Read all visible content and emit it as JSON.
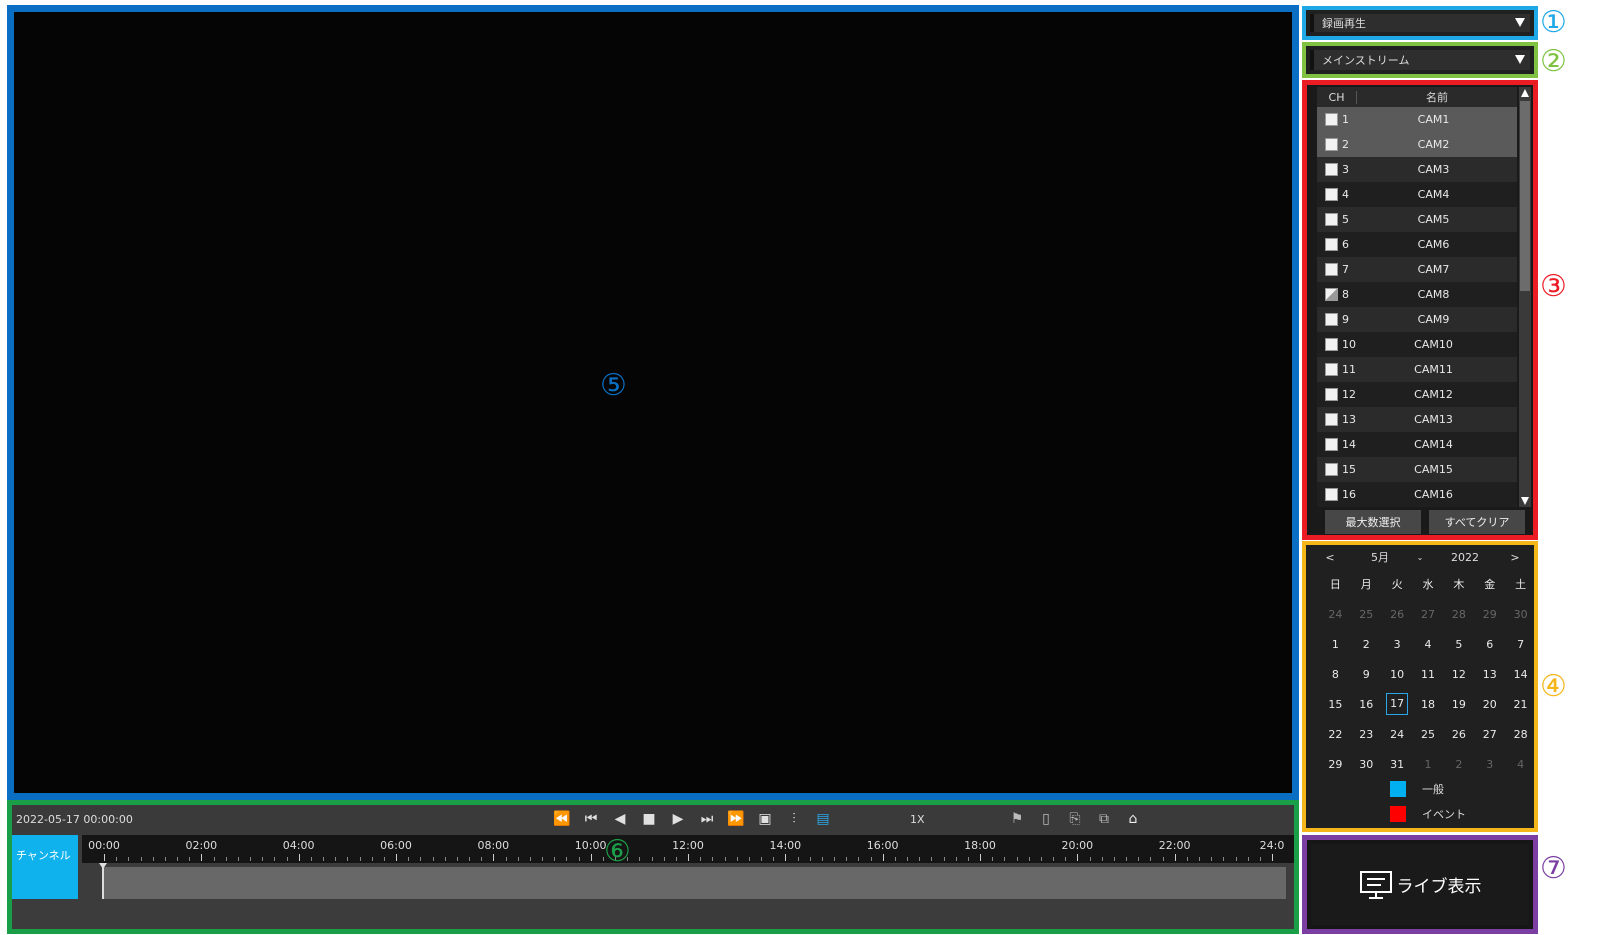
{
  "callouts": {
    "c1": "①",
    "c2": "②",
    "c3": "③",
    "c4": "④",
    "c5": "⑤",
    "c6": "⑥",
    "c7": "⑦"
  },
  "colors": {
    "frame1": "#1fa8e8",
    "frame2": "#7fc241",
    "frame3": "#ec1c24",
    "frame4": "#f4b619",
    "frame5": "#0a6fc2",
    "frame6": "#1b9e48",
    "frame7": "#7b3fa3",
    "legend_normal": "#00b0f0",
    "legend_event": "#ff0000"
  },
  "mode_select": {
    "value": "録画再生"
  },
  "stream_select": {
    "value": "メインストリーム"
  },
  "channels": {
    "header_ch": "CH",
    "header_name": "名前",
    "rows": [
      {
        "num": "1",
        "name": "CAM1"
      },
      {
        "num": "2",
        "name": "CAM2"
      },
      {
        "num": "3",
        "name": "CAM3"
      },
      {
        "num": "4",
        "name": "CAM4"
      },
      {
        "num": "5",
        "name": "CAM5"
      },
      {
        "num": "6",
        "name": "CAM6"
      },
      {
        "num": "7",
        "name": "CAM7"
      },
      {
        "num": "8",
        "name": "CAM8"
      },
      {
        "num": "9",
        "name": "CAM9"
      },
      {
        "num": "10",
        "name": "CAM10"
      },
      {
        "num": "11",
        "name": "CAM11"
      },
      {
        "num": "12",
        "name": "CAM12"
      },
      {
        "num": "13",
        "name": "CAM13"
      },
      {
        "num": "14",
        "name": "CAM14"
      },
      {
        "num": "15",
        "name": "CAM15"
      },
      {
        "num": "16",
        "name": "CAM16"
      }
    ],
    "select_max_label": "最大数選択",
    "clear_all_label": "すべてクリア"
  },
  "calendar": {
    "prev": "<",
    "next": ">",
    "month": "5月",
    "year": "2022",
    "weekdays": [
      "日",
      "月",
      "火",
      "水",
      "木",
      "金",
      "土"
    ],
    "weeks": [
      [
        "24",
        "25",
        "26",
        "27",
        "28",
        "29",
        "30"
      ],
      [
        "1",
        "2",
        "3",
        "4",
        "5",
        "6",
        "7"
      ],
      [
        "8",
        "9",
        "10",
        "11",
        "12",
        "13",
        "14"
      ],
      [
        "15",
        "16",
        "17",
        "18",
        "19",
        "20",
        "21"
      ],
      [
        "22",
        "23",
        "24",
        "25",
        "26",
        "27",
        "28"
      ],
      [
        "29",
        "30",
        "31",
        "1",
        "2",
        "3",
        "4"
      ]
    ],
    "selected_day": "17",
    "legend_normal": "一般",
    "legend_event": "イベント"
  },
  "timeline": {
    "timestamp": "2022-05-17 00:00:00",
    "speed": "1X",
    "channel_label": "チャンネル",
    "ticks": [
      "00:00",
      "02:00",
      "04:00",
      "06:00",
      "08:00",
      "10:00",
      "12:00",
      "14:00",
      "16:00",
      "18:00",
      "20:00",
      "22:00",
      "24:0"
    ]
  },
  "live_button": {
    "label": "ライブ表示"
  }
}
